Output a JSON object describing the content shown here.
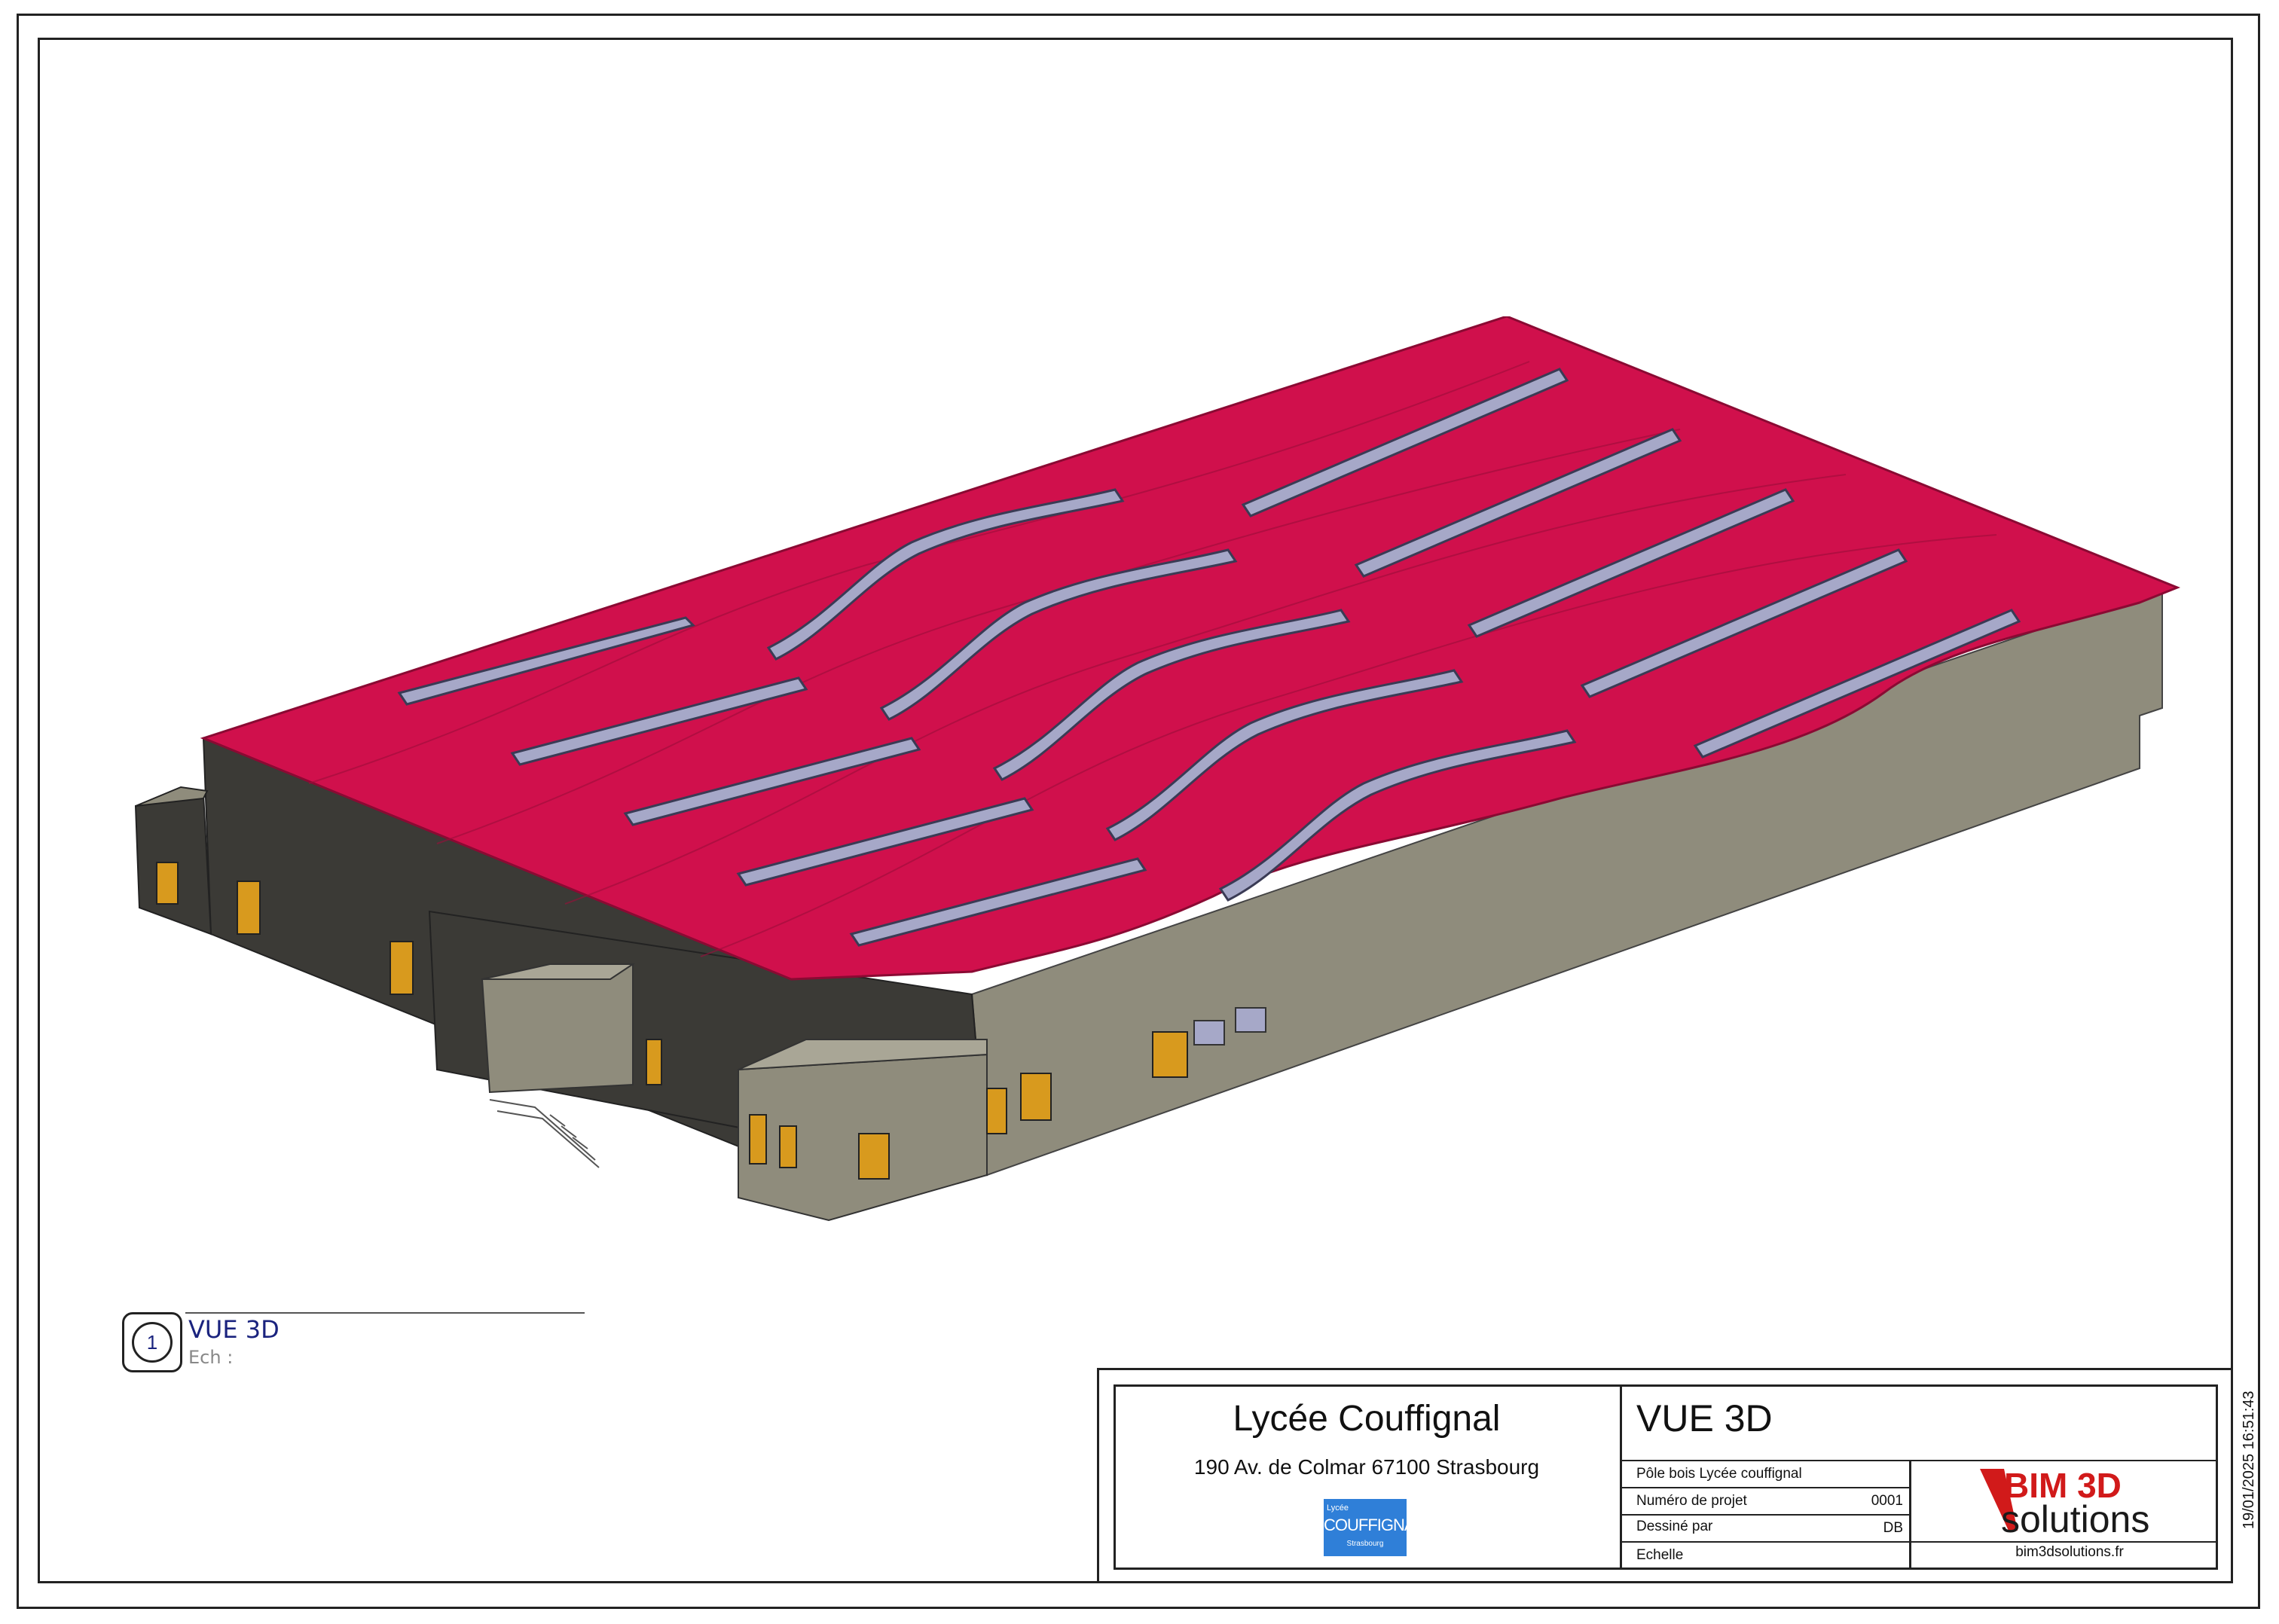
{
  "view": {
    "number": "1",
    "title": "VUE 3D",
    "scale_label": "Ech :"
  },
  "title_block": {
    "project_name": "Lycée Couffignal",
    "address": "190 Av. de Colmar 67100 Strasbourg",
    "school_logo": {
      "line1": "Lycée",
      "line2": "COUFFIGNAL",
      "line3": "Strasbourg"
    },
    "view_title": "VUE 3D",
    "rows": [
      {
        "label": "Pôle bois Lycée couffignal",
        "value": ""
      },
      {
        "label": "Numéro de projet",
        "value": "0001"
      },
      {
        "label": "Dessiné par",
        "value": "DB"
      },
      {
        "label": "Echelle",
        "value": ""
      }
    ],
    "company_logo": {
      "line1": "BIM 3D",
      "line2": "solutions"
    },
    "company_url": "bim3dsolutions.fr"
  },
  "timestamp": "19/01/2025 16:51:43",
  "colors": {
    "roof": "#d0104c",
    "wall_dark": "#3b3a36",
    "wall_light": "#8f8c7c",
    "door": "#d89a1e",
    "skylight": "#a6a8c8",
    "logo_blue": "#2f7fd8",
    "bim_red": "#d11a1a",
    "view_blue": "#1a237e"
  }
}
